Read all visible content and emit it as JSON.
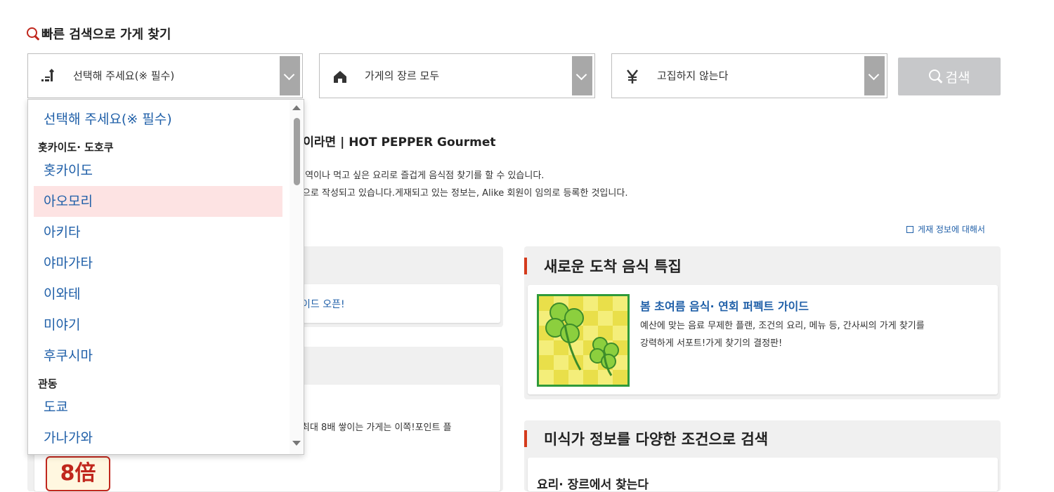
{
  "quick_search": {
    "title": "빠른 검색으로 가게 찾기"
  },
  "filters": {
    "area": {
      "value": "선택해 주세요(※ 필수)",
      "icon": "area-map-icon"
    },
    "genre": {
      "value": "가게의 장르 모두",
      "icon": "home-icon"
    },
    "budget": {
      "value": "고집하지 않는다",
      "icon": "yen-icon"
    },
    "search_label": "검색"
  },
  "dropdown": {
    "placeholder": "선택해 주세요(※ 필수)",
    "group1": "홋카이도· 도호쿠",
    "items1": [
      "홋카이도",
      "아오모리",
      "아키타",
      "야마가타",
      "이와테",
      "미야기",
      "후쿠시마"
    ],
    "group2": "관동",
    "items2": [
      "도쿄",
      "가나가와"
    ],
    "highlighted": "아오모리"
  },
  "intro": {
    "title": "검색이라면 | HOT PEPPER Gourmet",
    "line1": "은 역이나 먹고 싶은 요리로 즐겁게 음식점 찾기를 할 수 있습니다.",
    "line2": "방으로 작성되고 있습니다.게재되고 있는 정보는, Alike 회원이 임의로 등록한 것입니다.",
    "about_link": "게재 정보에 대해서"
  },
  "left_hidden": {
    "card1_text": "이드 오픈!",
    "card2_text": "최대 8배 쌓이는 가게는 이쪽!포인트 플",
    "promo_badge": "8倍"
  },
  "new_food": {
    "title": "새로운 도착 음식 특집",
    "feature_title": "봄 초여름 음식· 연회 퍼펙트 가이드",
    "feature_desc_1": "예산에 맞는 음료 무제한 플랜, 조건의 요리, 메뉴 등, 간사씨의 가게 찾기를",
    "feature_desc_2": "강력하게 서포트!가게 찾기의 결정판!",
    "image_icon": "four-leaf-clover-icon"
  },
  "gourmet": {
    "title": "미식가 정보를 다양한 조건으로 검색",
    "subtitle": "요리· 장르에서 찾는다"
  },
  "colors": {
    "accent_red": "#d43a1c",
    "link_blue": "#1f5fa8",
    "highlight": "#fde3e3"
  }
}
